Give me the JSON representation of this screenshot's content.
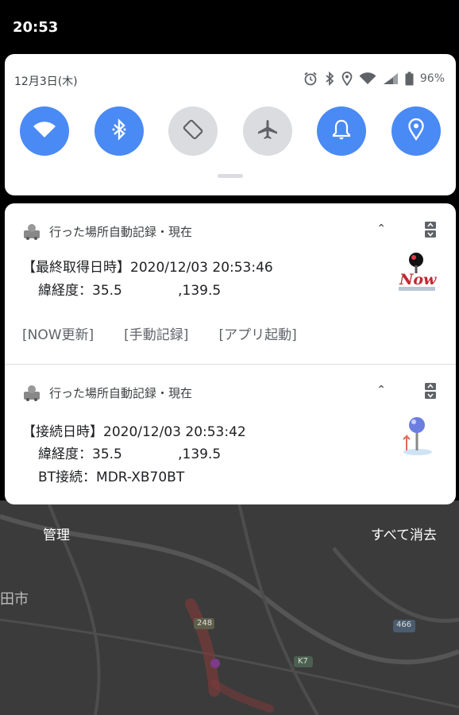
{
  "status_bar": {
    "time": "20:53"
  },
  "quick_settings": {
    "date": "12月3日(木)",
    "battery": "96%",
    "tiles": [
      {
        "name": "wifi",
        "state": "on"
      },
      {
        "name": "bluetooth",
        "state": "on"
      },
      {
        "name": "auto-rotate",
        "state": "off"
      },
      {
        "name": "airplane-mode",
        "state": "off"
      },
      {
        "name": "sound",
        "state": "on"
      },
      {
        "name": "location",
        "state": "on"
      }
    ]
  },
  "notifications": [
    {
      "app_title": "行った場所自動記録・現在",
      "line1": "【最終取得日時】2020/12/03 20:53:46",
      "line2": "緯経度：35.5             ,139.5",
      "actions": [
        "[NOW更新]",
        "[手動記録]",
        "[アプリ起動]"
      ],
      "thumb_text": "Now"
    },
    {
      "app_title": "行った場所自動記録・現在",
      "line1": "【接続日時】2020/12/03 20:53:42",
      "line2": "緯経度：35.5             ,139.5",
      "line3": "BT接続：MDR-XB70BT"
    }
  ],
  "footer": {
    "manage": "管理",
    "clear_all": "すべて消去"
  },
  "map": {
    "city_label": "田市",
    "road_labels": [
      "248",
      "466",
      "K7"
    ]
  }
}
